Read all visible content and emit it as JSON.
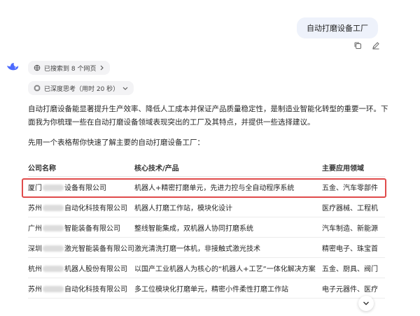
{
  "user_message": {
    "text": "自动打磨设备工厂"
  },
  "actions": {
    "copy_icon": "copy-icon",
    "edit_icon": "edit-icon"
  },
  "assistant": {
    "avatar_icon": "whale-logo-icon",
    "searched_label": "已搜索到 8 个网页",
    "think_label": "已深度思考（用时 20 秒）",
    "intro_1": "自动打磨设备能显著提升生产效率、降低人工成本并保证产品质量稳定性，是制造业智能化转型的重要一环。下面我为你梳理一些在自动打磨设备领域表现突出的工厂及其特点，并提供一些选择建议。",
    "intro_2": "先用一个表格帮你快速了解主要的自动打磨设备工厂："
  },
  "table": {
    "headers": [
      "公司名称",
      "核心技术/产品",
      "主要应用领域"
    ],
    "rows": [
      {
        "name_prefix": "厦门",
        "name_suffix": "设备有限公司",
        "tech": "机器人+精密打磨单元，先进力控与全自动程序系统",
        "field": "五金、汽车零部件"
      },
      {
        "name_prefix": "苏州",
        "name_suffix": "自动化科技有限公司",
        "tech": "机器人打磨工作站，模块化设计",
        "field": "医疗器械、工程机"
      },
      {
        "name_prefix": "广州",
        "name_suffix": "智能装备有限公司",
        "tech": "整线智能集成，双机器人协同打磨系统",
        "field": "汽车制造、新能源"
      },
      {
        "name_prefix": "深圳",
        "name_suffix": "激光智能装备有限公司",
        "tech": "激光清洗打磨一体机，非接触式激光技术",
        "field": "精密电子、珠宝首"
      },
      {
        "name_prefix": "杭州",
        "name_suffix": "机器人股份有限公司",
        "tech": "以国产工业机器人为核心的“机器人+工艺”一体化解决方案",
        "field": "五金、厨具、阀门"
      },
      {
        "name_prefix": "苏州",
        "name_suffix": "自动化科技有限公司",
        "tech": "多工位模块化打磨单元，精密小件柔性打磨工作站",
        "field": "电子元器件、医疗"
      }
    ]
  },
  "highlight_color": "#e04b4b",
  "scroll_icon": "chevron-down-icon"
}
